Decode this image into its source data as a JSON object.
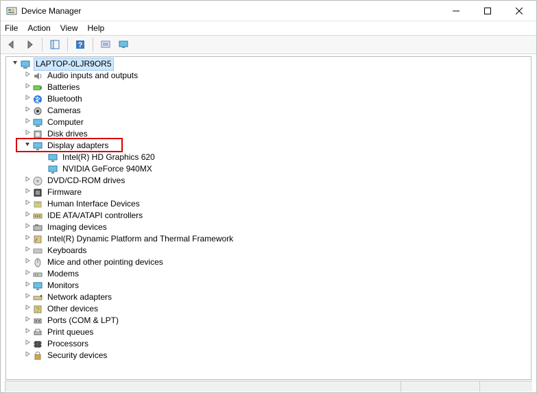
{
  "window": {
    "title": "Device Manager",
    "controls": {
      "minimize": "min",
      "maximize": "max",
      "close": "close"
    }
  },
  "menu": {
    "items": [
      "File",
      "Action",
      "View",
      "Help"
    ]
  },
  "toolbar": {
    "back": "back",
    "forward": "forward",
    "show_hide_tree": "show-hide-console-tree",
    "help": "help",
    "scan": "scan-for-hardware-changes",
    "view_devices": "devices-by-type"
  },
  "tree": {
    "root": {
      "label": "LAPTOP-0LJR9OR5",
      "expanded": true,
      "selected": true
    },
    "nodes": [
      {
        "label": "Audio inputs and outputs",
        "expanded": false,
        "icon": "audio"
      },
      {
        "label": "Batteries",
        "expanded": false,
        "icon": "battery"
      },
      {
        "label": "Bluetooth",
        "expanded": false,
        "icon": "bluetooth"
      },
      {
        "label": "Cameras",
        "expanded": false,
        "icon": "camera"
      },
      {
        "label": "Computer",
        "expanded": false,
        "icon": "computer"
      },
      {
        "label": "Disk drives",
        "expanded": false,
        "icon": "disk"
      },
      {
        "label": "Display adapters",
        "expanded": true,
        "icon": "display",
        "highlighted": true,
        "children": [
          {
            "label": "Intel(R) HD Graphics 620",
            "icon": "display"
          },
          {
            "label": "NVIDIA GeForce 940MX",
            "icon": "display"
          }
        ]
      },
      {
        "label": "DVD/CD-ROM drives",
        "expanded": false,
        "icon": "dvd"
      },
      {
        "label": "Firmware",
        "expanded": false,
        "icon": "firmware"
      },
      {
        "label": "Human Interface Devices",
        "expanded": false,
        "icon": "hid"
      },
      {
        "label": "IDE ATA/ATAPI controllers",
        "expanded": false,
        "icon": "ide"
      },
      {
        "label": "Imaging devices",
        "expanded": false,
        "icon": "imaging"
      },
      {
        "label": "Intel(R) Dynamic Platform and Thermal Framework",
        "expanded": false,
        "icon": "thermal"
      },
      {
        "label": "Keyboards",
        "expanded": false,
        "icon": "keyboard"
      },
      {
        "label": "Mice and other pointing devices",
        "expanded": false,
        "icon": "mouse"
      },
      {
        "label": "Modems",
        "expanded": false,
        "icon": "modem"
      },
      {
        "label": "Monitors",
        "expanded": false,
        "icon": "monitor"
      },
      {
        "label": "Network adapters",
        "expanded": false,
        "icon": "network"
      },
      {
        "label": "Other devices",
        "expanded": false,
        "icon": "other"
      },
      {
        "label": "Ports (COM & LPT)",
        "expanded": false,
        "icon": "port"
      },
      {
        "label": "Print queues",
        "expanded": false,
        "icon": "printer"
      },
      {
        "label": "Processors",
        "expanded": false,
        "icon": "cpu"
      },
      {
        "label": "Security devices",
        "expanded": false,
        "icon": "security"
      }
    ]
  }
}
